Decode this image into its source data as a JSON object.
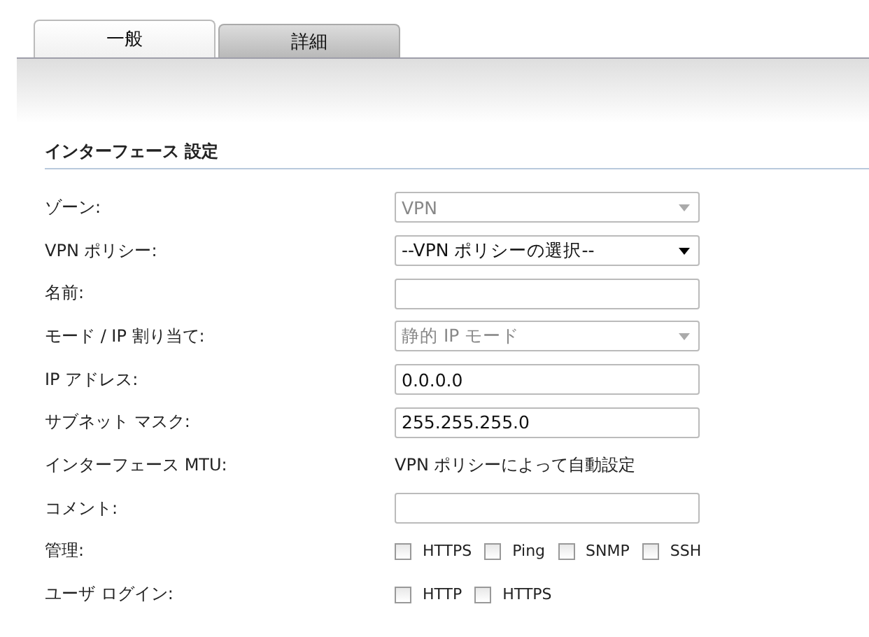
{
  "tabs": [
    {
      "label": "一般",
      "selected": true
    },
    {
      "label": "詳細",
      "selected": false
    }
  ],
  "section": {
    "title": "インターフェース 設定"
  },
  "rows": [
    {
      "label": "ゾーン:",
      "kind": "select",
      "value": "VPN",
      "disabled": true
    },
    {
      "label": "VPN ポリシー:",
      "kind": "select",
      "value": "--VPN ポリシーの選択--",
      "disabled": false
    },
    {
      "label": "名前:",
      "kind": "input",
      "value": ""
    },
    {
      "label": "モード / IP 割り当て:",
      "kind": "select",
      "value": "静的 IP モード",
      "disabled": true
    },
    {
      "label": "IP アドレス:",
      "kind": "input",
      "value": "0.0.0.0"
    },
    {
      "label": "サブネット マスク:",
      "kind": "input",
      "value": "255.255.255.0"
    },
    {
      "label": "インターフェース MTU:",
      "kind": "text",
      "value": "VPN ポリシーによって自動設定"
    },
    {
      "label": "コメント:",
      "kind": "input",
      "value": ""
    },
    {
      "label": "管理:",
      "kind": "checks",
      "options": [
        {
          "label": "HTTPS",
          "checked": false
        },
        {
          "label": "Ping",
          "checked": false
        },
        {
          "label": "SNMP",
          "checked": false
        },
        {
          "label": "SSH",
          "checked": false
        }
      ]
    },
    {
      "label": "ユーザ ログイン:",
      "kind": "checks",
      "options": [
        {
          "label": "HTTP",
          "checked": false
        },
        {
          "label": "HTTPS",
          "checked": false
        }
      ]
    }
  ]
}
